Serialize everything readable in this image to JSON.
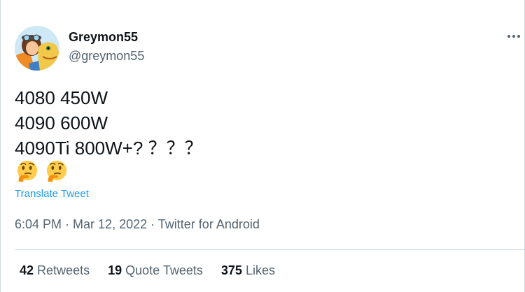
{
  "author": {
    "display_name": "Greymon55",
    "handle": "@greymon55"
  },
  "tweet": {
    "lines": [
      "4080 450W",
      "4090 600W",
      "4090Ti 800W+? ？？？"
    ],
    "emojis": [
      "thinking-face",
      "thinking-face"
    ],
    "translate_label": "Translate Tweet"
  },
  "meta": {
    "time": "6:04 PM",
    "separator": " · ",
    "date": "Mar 12, 2022",
    "source": "Twitter for Android"
  },
  "stats": {
    "retweets": {
      "count": "42",
      "label": "Retweets"
    },
    "quotes": {
      "count": "19",
      "label": "Quote Tweets"
    },
    "likes": {
      "count": "375",
      "label": "Likes"
    }
  },
  "colors": {
    "text": "#0f1419",
    "secondary": "#536471",
    "link": "#1d9bf0",
    "border": "#cfd9de"
  }
}
